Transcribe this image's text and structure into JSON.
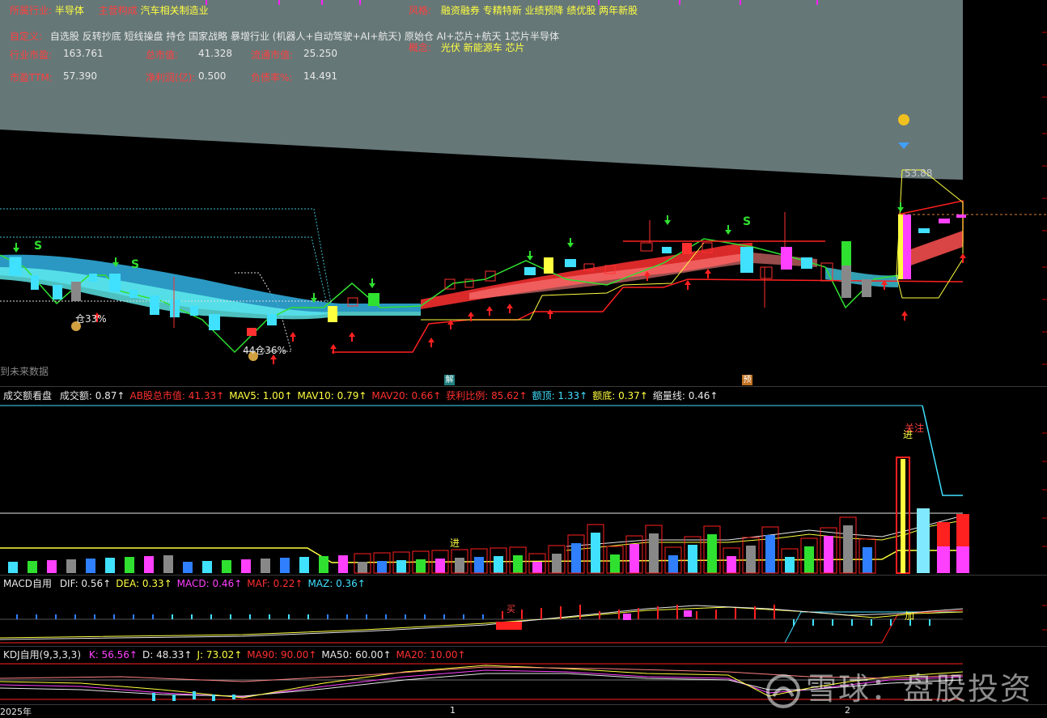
{
  "info": {
    "industry_label": "所属行业:",
    "industry_value": "半导体",
    "main_label": "主营构成",
    "main_value": "汽车相关制造业",
    "style_label": "风格:",
    "style_value": "融资融券 专精特新 业绩预降 绩优股 两年新股",
    "custom_label": "自定义:",
    "custom_value": "自选股 反转抄底 短线操盘 持仓 国家战略 暴增行业 (机器人+自动驾驶+AI+航天)  原始仓 AI+芯片+航天 1芯片半导体",
    "concept_label": "概念:",
    "concept_value": "光伏 新能源车 芯片",
    "ind_pe_label": "行业市盈:",
    "ind_pe_value": "163.761",
    "total_mv_label": "总市值:",
    "total_mv_value": "41.328",
    "float_mv_label": "流通市值:",
    "float_mv_value": "25.250",
    "pe_ttm_label": "市盈TTM:",
    "pe_ttm_value": "57.390",
    "net_profit_label": "净利润(亿):",
    "net_profit_value": "0.500",
    "debt_label": "负债率%:",
    "debt_value": "14.491"
  },
  "main_chart": {
    "price_label": "53.88",
    "ann_1": "仓33%",
    "ann_2": "44仓36%",
    "future_note": "到未来数据",
    "marker_jie": "解",
    "marker_yu": "预",
    "signal_s": "S"
  },
  "volume_panel": {
    "title": "成交额看盘",
    "items": [
      {
        "label": "成交额:",
        "value": "0.87",
        "color": "#e8e8e8"
      },
      {
        "label": "AB股总市值:",
        "value": "41.33",
        "color": "#ff3030"
      },
      {
        "label": "MAV5:",
        "value": "1.00",
        "color": "#ffff40"
      },
      {
        "label": "MAV10:",
        "value": "0.79",
        "color": "#ffff40"
      },
      {
        "label": "MAV20:",
        "value": "0.66",
        "color": "#ff3030"
      },
      {
        "label": "获利比例:",
        "value": "85.62",
        "color": "#ff3030"
      },
      {
        "label": "额顶:",
        "value": "1.33",
        "color": "#40e0ff"
      },
      {
        "label": "额底:",
        "value": "0.37",
        "color": "#ffff40"
      },
      {
        "label": "缩量线:",
        "value": "0.46",
        "color": "#e8e8e8"
      }
    ],
    "marker_jin": "进",
    "marker_zhuyi": "关注"
  },
  "macd_panel": {
    "title": "MACD自用",
    "items": [
      {
        "label": "DIF:",
        "value": "0.56",
        "color": "#e8e8e8"
      },
      {
        "label": "DEA:",
        "value": "0.33",
        "color": "#ffff40"
      },
      {
        "label": "MACD:",
        "value": "0.46",
        "color": "#ff40ff"
      },
      {
        "label": "MAF:",
        "value": "0.22",
        "color": "#ff3030"
      },
      {
        "label": "MAZ:",
        "value": "0.36",
        "color": "#40e0ff"
      }
    ],
    "marker_mai": "买",
    "marker_jia": "加"
  },
  "kdj_panel": {
    "title": "KDJ自用(9,3,3,3)",
    "items": [
      {
        "label": "K:",
        "value": "56.56",
        "color": "#ff40ff"
      },
      {
        "label": "D:",
        "value": "48.33",
        "color": "#e8e8e8"
      },
      {
        "label": "J:",
        "value": "73.02",
        "color": "#ffff40"
      },
      {
        "label": "MA90:",
        "value": "90.00",
        "color": "#ff3030"
      },
      {
        "label": "MA50:",
        "value": "60.00",
        "color": "#e8e8e8"
      },
      {
        "label": "MA20:",
        "value": "10.00",
        "color": "#ff3030"
      }
    ]
  },
  "time_axis": {
    "year_label": "2025年",
    "month_1": "1",
    "month_2": "2"
  },
  "watermark": {
    "text": "雪球：盘股投资"
  }
}
